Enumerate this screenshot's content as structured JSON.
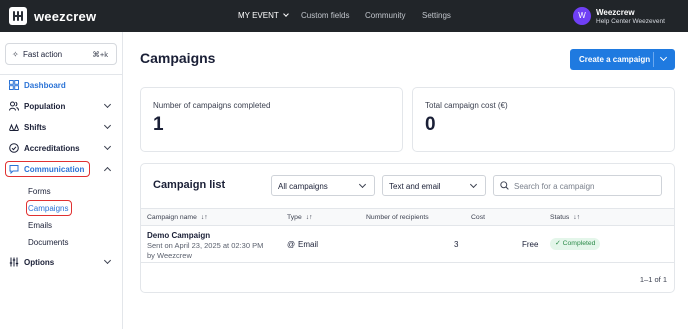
{
  "topbar": {
    "brand": "weezcrew",
    "nav_event": "MY EVENT",
    "nav_custom_fields": "Custom fields",
    "nav_community": "Community",
    "nav_settings": "Settings",
    "avatar_letter": "W",
    "user_name": "Weezcrew",
    "user_org": "Help Center Weezevent"
  },
  "sidebar": {
    "fast_action": "Fast action",
    "fast_shortcut": "⌘+k",
    "dashboard": "Dashboard",
    "population": "Population",
    "shifts": "Shifts",
    "accreditations": "Accreditations",
    "communication": "Communication",
    "sub_items": [
      "Forms",
      "Campaigns",
      "Emails",
      "Documents"
    ],
    "options": "Options"
  },
  "main": {
    "title": "Campaigns",
    "create_button": "Create a campaign",
    "stats": [
      {
        "label": "Number of campaigns completed",
        "value": "1"
      },
      {
        "label": "Total campaign cost (€)",
        "value": "0"
      }
    ],
    "list": {
      "title": "Campaign list",
      "filter_campaigns": "All campaigns",
      "filter_channel": "Text and email",
      "search_placeholder": "Search for a campaign",
      "columns": {
        "name": "Campaign name",
        "type": "Type",
        "recipients": "Number of recipients",
        "cost": "Cost",
        "status": "Status"
      },
      "rows": [
        {
          "name": "Demo Campaign",
          "sent": "Sent on April 23, 2025 at 02:30 PM",
          "by": "by Weezcrew",
          "type": "Email",
          "recipients": "3",
          "cost": "Free",
          "status": "Completed"
        }
      ],
      "pagination": "1–1 of 1"
    }
  },
  "colors": {
    "topbar": "#212529",
    "primary": "#1f7ae0",
    "active_nav": "#2b73d6",
    "highlight": "#e03131",
    "status_completed": "#2b8a48"
  }
}
